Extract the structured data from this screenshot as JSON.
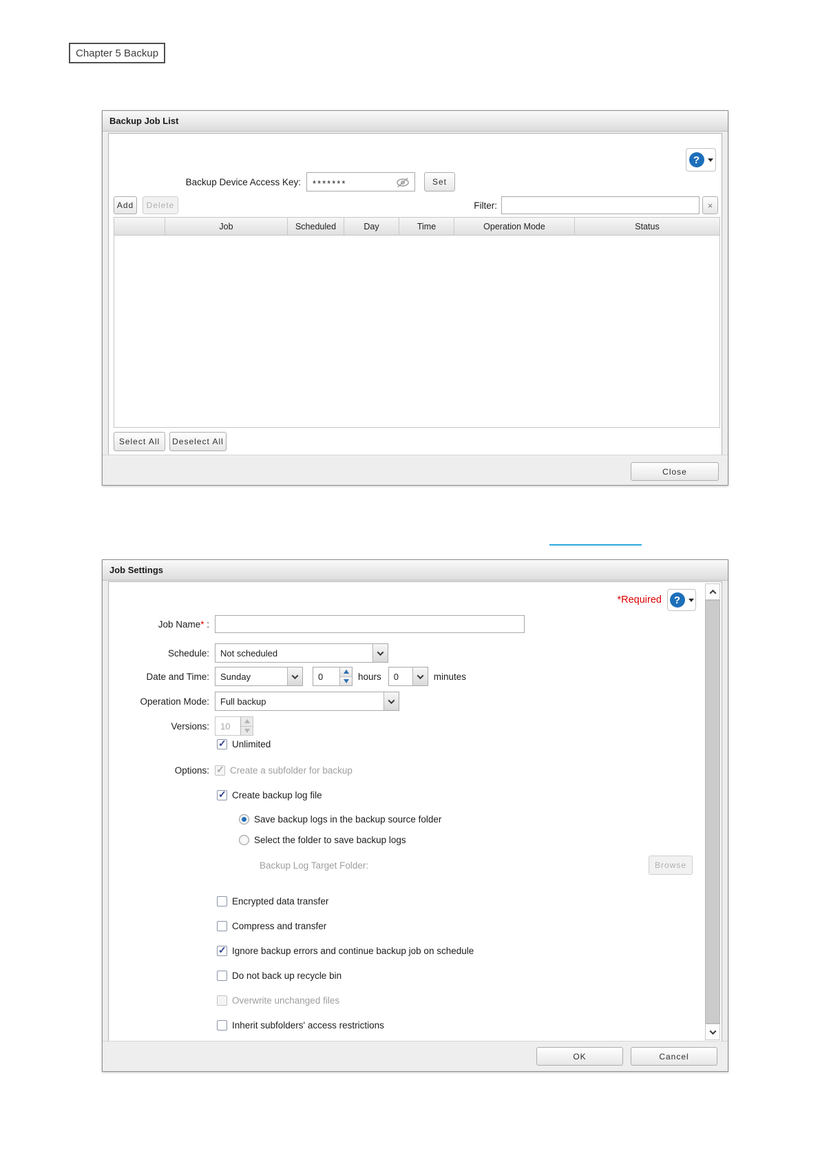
{
  "page": {
    "chapter_label": "Chapter 5 Backup"
  },
  "accent_colors": {
    "divider_blue": "#2BA9DE",
    "help_blue": "#1d6fba",
    "required_red": "#dd0000"
  },
  "backup_job_list": {
    "title": "Backup Job List",
    "help_button": {
      "icon": "?"
    },
    "access_key": {
      "label": "Backup Device Access Key:",
      "value": "*******",
      "set_label": "Set"
    },
    "toolbar": {
      "add_label": "Add",
      "delete_label": "Delete",
      "filter_label": "Filter:",
      "filter_value": "",
      "clear_label": "×"
    },
    "table": {
      "columns": [
        "",
        "Job",
        "Scheduled",
        "Day",
        "Time",
        "Operation Mode",
        "Status"
      ],
      "rows": []
    },
    "actions": {
      "select_all_label": "Select All",
      "deselect_all_label": "Deselect All",
      "close_label": "Close"
    }
  },
  "job_settings": {
    "title": "Job Settings",
    "required_note": "*Required",
    "help_button": {
      "icon": "?"
    },
    "job_name": {
      "label": "Job Name",
      "required_mark": "*",
      "colon": " :",
      "value": ""
    },
    "schedule": {
      "label": "Schedule:",
      "value": "Not scheduled"
    },
    "date_time": {
      "label": "Date and Time:",
      "day": "Sunday",
      "hours": "0",
      "hours_unit": "hours",
      "minutes": "0",
      "minutes_unit": "minutes"
    },
    "operation_mode": {
      "label": "Operation Mode:",
      "value": "Full backup"
    },
    "versions": {
      "label": "Versions:",
      "value": "10",
      "disabled": true
    },
    "unlimited": {
      "label": "Unlimited",
      "checked": true
    },
    "options": {
      "label": "Options:",
      "create_subfolder": {
        "label": "Create a subfolder for backup",
        "checked": true,
        "disabled": true
      },
      "create_log": {
        "label": "Create backup log file",
        "checked": true
      },
      "log_radio_source": {
        "label": "Save backup logs in the backup source folder",
        "selected": true
      },
      "log_radio_select": {
        "label": "Select the folder to save backup logs",
        "selected": false
      },
      "log_target": {
        "label": "Backup Log Target Folder:",
        "browse_label": "Browse",
        "disabled": true
      },
      "encrypted": {
        "label": "Encrypted data transfer",
        "checked": false
      },
      "compress": {
        "label": "Compress and transfer",
        "checked": false
      },
      "ignore_errors": {
        "label": "Ignore backup errors and continue backup job on schedule",
        "checked": true
      },
      "no_recycle_bin": {
        "label": "Do not back up recycle bin",
        "checked": false
      },
      "overwrite_unchanged": {
        "label": "Overwrite unchanged files",
        "checked": false,
        "disabled": true
      },
      "inherit_restrictions": {
        "label": "Inherit subfolders' access restrictions",
        "checked": false
      }
    },
    "footer": {
      "ok_label": "OK",
      "cancel_label": "Cancel"
    }
  }
}
